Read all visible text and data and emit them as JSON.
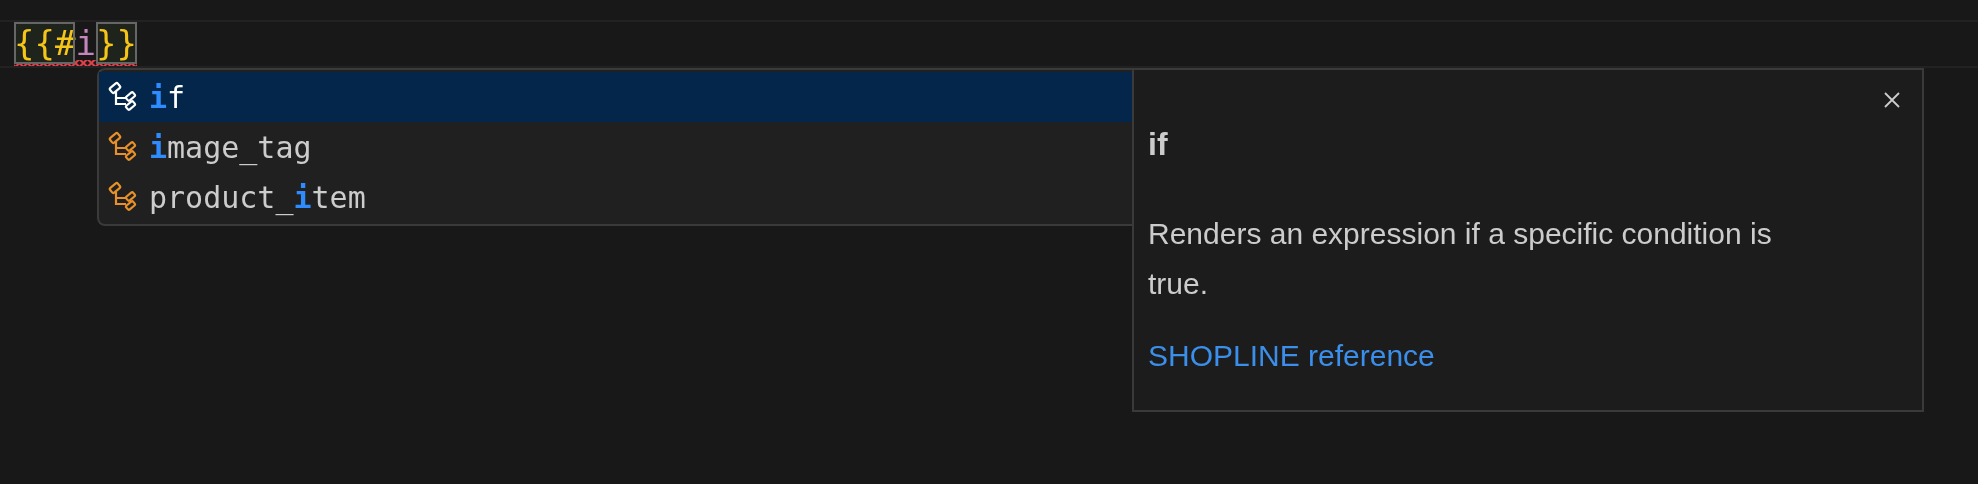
{
  "editor": {
    "line": {
      "error": true,
      "tokens": [
        {
          "text": "{{#",
          "kind": "bracket",
          "matched": true
        },
        {
          "text": "i",
          "kind": "identifier",
          "matched": false
        },
        {
          "text": "}}",
          "kind": "bracket",
          "matched": true
        }
      ]
    }
  },
  "suggestions": [
    {
      "selected": true,
      "parts": [
        {
          "text": "i",
          "match": true
        },
        {
          "text": "f",
          "match": false
        }
      ]
    },
    {
      "selected": false,
      "parts": [
        {
          "text": "i",
          "match": true
        },
        {
          "text": "mage_tag",
          "match": false
        }
      ]
    },
    {
      "selected": false,
      "parts": [
        {
          "text": "product_",
          "match": false
        },
        {
          "text": "i",
          "match": true
        },
        {
          "text": "tem",
          "match": false
        }
      ]
    }
  ],
  "details": {
    "title": "if",
    "description": "Renders an expression if a specific condition is true.",
    "link": "SHOPLINE reference"
  }
}
